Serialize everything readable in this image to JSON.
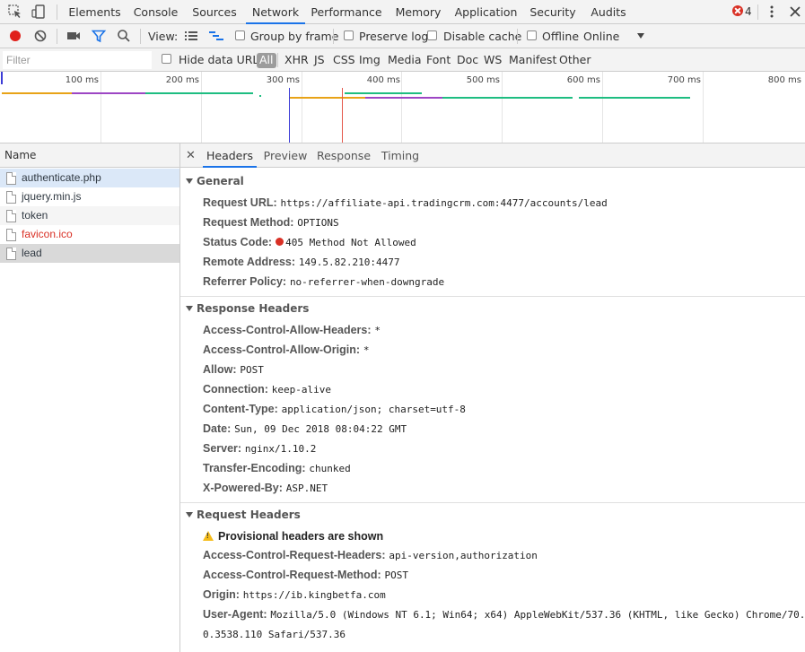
{
  "devtools": {
    "tabs": [
      "Elements",
      "Console",
      "Sources",
      "Network",
      "Performance",
      "Memory",
      "Application",
      "Security",
      "Audits"
    ],
    "active_tab": "Network",
    "error_count": "4"
  },
  "toolbar": {
    "view_label": "View:",
    "group_by_frame": "Group by frame",
    "preserve_log": "Preserve log",
    "disable_cache": "Disable cache",
    "offline": "Offline",
    "throttling": "Online"
  },
  "filter": {
    "placeholder": "Filter",
    "hide_data_urls": "Hide data URLs",
    "types": [
      "All",
      "XHR",
      "JS",
      "CSS",
      "Img",
      "Media",
      "Font",
      "Doc",
      "WS",
      "Manifest",
      "Other"
    ],
    "selected_type": "All"
  },
  "timeline": {
    "ticks": [
      "100 ms",
      "200 ms",
      "300 ms",
      "400 ms",
      "500 ms",
      "600 ms",
      "700 ms",
      "800 ms"
    ],
    "colors": {
      "waiting": "#e8a317",
      "dom": "#9d46c4",
      "download": "#1ebd81",
      "load": "#e4574a",
      "domcontent": "#3c3cd6"
    }
  },
  "requests": {
    "column_name": "Name",
    "items": [
      {
        "name": "authenticate.php",
        "state": "selected"
      },
      {
        "name": "jquery.min.js",
        "state": "normal"
      },
      {
        "name": "token",
        "state": "alt"
      },
      {
        "name": "favicon.ico",
        "state": "error"
      },
      {
        "name": "lead",
        "state": "dark"
      }
    ]
  },
  "details": {
    "tabs": [
      "Headers",
      "Preview",
      "Response",
      "Timing"
    ],
    "active_tab": "Headers",
    "general": {
      "title": "General",
      "request_url_label": "Request URL:",
      "request_url": "https://affiliate-api.tradingcrm.com:4477/accounts/lead",
      "request_method_label": "Request Method:",
      "request_method": "OPTIONS",
      "status_code_label": "Status Code:",
      "status_code": "405 Method Not Allowed",
      "remote_address_label": "Remote Address:",
      "remote_address": "149.5.82.210:4477",
      "referrer_policy_label": "Referrer Policy:",
      "referrer_policy": "no-referrer-when-downgrade"
    },
    "response_headers": {
      "title": "Response Headers",
      "items": [
        {
          "name": "Access-Control-Allow-Headers:",
          "value": "*"
        },
        {
          "name": "Access-Control-Allow-Origin:",
          "value": "*"
        },
        {
          "name": "Allow:",
          "value": "POST"
        },
        {
          "name": "Connection:",
          "value": "keep-alive"
        },
        {
          "name": "Content-Type:",
          "value": "application/json; charset=utf-8"
        },
        {
          "name": "Date:",
          "value": "Sun, 09 Dec 2018 08:04:22 GMT"
        },
        {
          "name": "Server:",
          "value": "nginx/1.10.2"
        },
        {
          "name": "Transfer-Encoding:",
          "value": "chunked"
        },
        {
          "name": "X-Powered-By:",
          "value": "ASP.NET"
        }
      ]
    },
    "request_headers": {
      "title": "Request Headers",
      "provisional": "Provisional headers are shown",
      "items": [
        {
          "name": "Access-Control-Request-Headers:",
          "value": "api-version,authorization"
        },
        {
          "name": "Access-Control-Request-Method:",
          "value": "POST"
        },
        {
          "name": "Origin:",
          "value": "https://ib.kingbetfa.com"
        },
        {
          "name": "User-Agent:",
          "value": "Mozilla/5.0 (Windows NT 6.1; Win64; x64) AppleWebKit/537.36 (KHTML, like Gecko) Chrome/70."
        },
        {
          "name": "",
          "value": "0.3538.110 Safari/537.36"
        }
      ]
    }
  }
}
